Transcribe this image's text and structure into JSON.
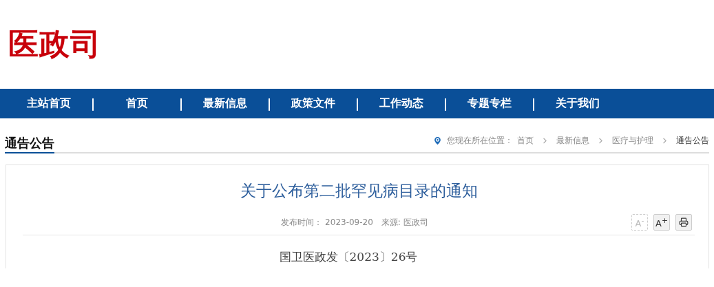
{
  "site_title": "医政司",
  "nav": [
    {
      "label": "主站首页",
      "selected": false
    },
    {
      "label": "首页",
      "selected": false
    },
    {
      "label": "最新信息",
      "selected": false
    },
    {
      "label": "政策文件",
      "selected": false
    },
    {
      "label": "工作动态",
      "selected": false
    },
    {
      "label": "专题专栏",
      "selected": false
    },
    {
      "label": "关于我们",
      "selected": false
    }
  ],
  "nav_separator": "|",
  "section_title": "通告公告",
  "breadcrumb": {
    "prefix": "您现在所在位置：",
    "items": [
      "首页",
      "最新信息",
      "医疗与护理",
      "通告公告"
    ]
  },
  "article": {
    "title": "关于公布第二批罕见病目录的通知",
    "published_label": "发布时间：",
    "published": "2023-09-20",
    "source": "来源: 医政司",
    "tools": [
      {
        "kind": "text",
        "label": "A$^{-}$",
        "disabled": true
      },
      {
        "kind": "text",
        "label": "A$^{+}$",
        "disabled": false
      },
      {
        "kind": "print",
        "disabled": false
      }
    ],
    "doc_number": "国卫医政发〔2023〕26号"
  }
}
